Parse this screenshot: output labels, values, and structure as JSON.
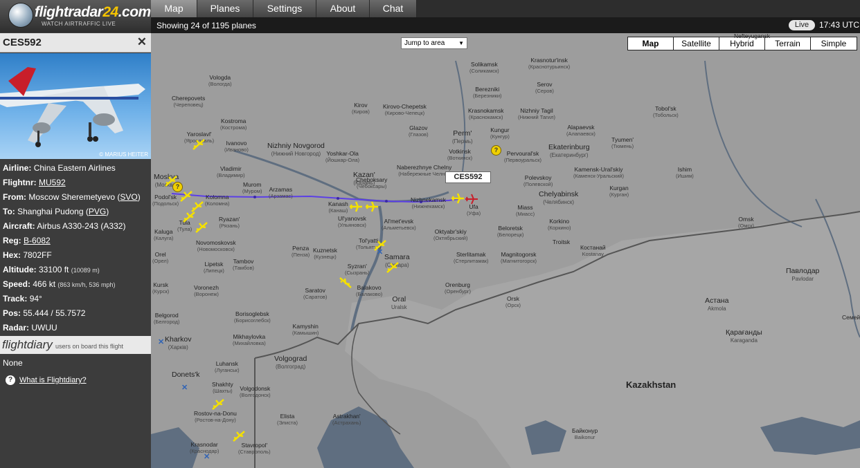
{
  "logo": {
    "brand_main": "flightradar",
    "brand_num": "24",
    "brand_tld": ".com",
    "tagline": "WATCH AIRTRAFFIC LIVE"
  },
  "nav": {
    "tabs": [
      "Map",
      "Planes",
      "Settings",
      "About",
      "Chat"
    ],
    "active": "Map"
  },
  "status": {
    "showing": "Showing 24 of 1195 planes",
    "live": "Live",
    "time": "17:43 UTC"
  },
  "flight": {
    "callsign": "CES592",
    "photo_credit": "© MARIUS HEITER",
    "airline_label": "Airline:",
    "airline": "China Eastern Airlines",
    "flightnr_label": "Flightnr:",
    "flightnr": "MU592",
    "from_label": "From:",
    "from": "Moscow Sheremetyevo (",
    "from_code": "SVO",
    "from_close": ")",
    "to_label": "To:",
    "to": "Shanghai Pudong (",
    "to_code": "PVG",
    "to_close": ")",
    "aircraft_label": "Aircraft:",
    "aircraft": "Airbus A330-243 (A332)",
    "reg_label": "Reg:",
    "reg": "B-6082",
    "hex_label": "Hex:",
    "hex": "7802FF",
    "altitude_label": "Altitude:",
    "altitude": "33100 ft",
    "altitude_m": "(10089 m)",
    "speed_label": "Speed:",
    "speed": "466 kt",
    "speed_alt": "(863 km/h, 536 mph)",
    "track_label": "Track:",
    "track": "94°",
    "pos_label": "Pos:",
    "pos": "55.444 / 55.7572",
    "radar_label": "Radar:",
    "radar": "UWUU"
  },
  "flightdiary": {
    "logo": "flightdiary",
    "text": "users on board this flight",
    "none": "None",
    "what": "What is Flightdiary?"
  },
  "map": {
    "jump": "Jump to area",
    "types": [
      "Map",
      "Satellite",
      "Hybrid",
      "Terrain",
      "Simple"
    ],
    "active_type": "Map",
    "selected_label": "CES592",
    "country": "Kazakhstan",
    "cities": [
      {
        "en": "Solikamsk",
        "ru": "(Соликамск)"
      },
      {
        "en": "Krasnotur'insk",
        "ru": "(Краснотурьинск)"
      },
      {
        "en": "Berezniki",
        "ru": "(Березники)"
      },
      {
        "en": "Serov",
        "ru": "(Серов)"
      },
      {
        "en": "Vologda",
        "ru": "(Вологда)"
      },
      {
        "en": "Cherepovets",
        "ru": "(Череповец)"
      },
      {
        "en": "Kirov",
        "ru": "(Киров)"
      },
      {
        "en": "Kirovo-Chepetsk",
        "ru": "(Кирово-Чепецк)"
      },
      {
        "en": "Krasnokamsk",
        "ru": "(Краснокамск)"
      },
      {
        "en": "Nizhniy Tagil",
        "ru": "(Нижний Тагил)"
      },
      {
        "en": "Tobol'sk",
        "ru": "(Тобольск)"
      },
      {
        "en": "Kostroma",
        "ru": "(Кострома)"
      },
      {
        "en": "Glazov",
        "ru": "(Глазов)"
      },
      {
        "en": "Perm'",
        "ru": "(Пермь)"
      },
      {
        "en": "Kungur",
        "ru": "(Кунгур)"
      },
      {
        "en": "Alapaevsk",
        "ru": "(Алапаевск)"
      },
      {
        "en": "Yaroslavl'",
        "ru": "(Ярославль)"
      },
      {
        "en": "Ivanovo",
        "ru": "(Иваново)"
      },
      {
        "en": "Nizhniy Novgorod",
        "ru": "(Нижний Новгород)"
      },
      {
        "en": "Yoshkar-Ola",
        "ru": "(Йошкар-Ола)"
      },
      {
        "en": "Votkinsk",
        "ru": "(Воткинск)"
      },
      {
        "en": "Pervoural'sk",
        "ru": "(Первоуральск)"
      },
      {
        "en": "Ekaterinburg",
        "ru": "(Екатеринбург)"
      },
      {
        "en": "Tyumen'",
        "ru": "(Тюмень)"
      },
      {
        "en": "Vladimir",
        "ru": "(Владимир)"
      },
      {
        "en": "Kazan'",
        "ru": "(Казань)"
      },
      {
        "en": "Naberezhnye Chelny",
        "ru": "(Набережные Челны)"
      },
      {
        "en": "Kamensk-Ural'skiy",
        "ru": "(Каменск-Уральский)"
      },
      {
        "en": "Ishim",
        "ru": "(Ишим)"
      },
      {
        "en": "Moskva",
        "ru": "(Москва)"
      },
      {
        "en": "Murom",
        "ru": "(Муром)"
      },
      {
        "en": "Arzamas",
        "ru": "(Арзамас)"
      },
      {
        "en": "Polevskoy",
        "ru": "(Полевской)"
      },
      {
        "en": "Chelyabinsk",
        "ru": "(Челябинск)"
      },
      {
        "en": "Kurgan",
        "ru": "(Курган)"
      },
      {
        "en": "Podol'sk",
        "ru": "(Подольск)"
      },
      {
        "en": "Kolomna",
        "ru": "(Коломна)"
      },
      {
        "en": "Kanash",
        "ru": "(Канаш)"
      },
      {
        "en": "Cheboksary",
        "ru": "(Чебоксары)"
      },
      {
        "en": "Nizhnekamsk",
        "ru": "(Нижнекамск)"
      },
      {
        "en": "Ufa",
        "ru": "(Уфа)"
      },
      {
        "en": "Miass",
        "ru": "(Миасс)"
      },
      {
        "en": "Ul'yanovsk",
        "ru": "(Ульяновск)"
      },
      {
        "en": "Al'met'evsk",
        "ru": "(Альметьевск)"
      },
      {
        "en": "Korkino",
        "ru": "(Коркино)"
      },
      {
        "en": "Omsk",
        "ru": "(Омск)"
      },
      {
        "en": "Tula",
        "ru": "(Тула)"
      },
      {
        "en": "Ryazan'",
        "ru": "(Рязань)"
      },
      {
        "en": "Oktyabr'skiy",
        "ru": "(Октябрьский)"
      },
      {
        "en": "Beloretsk",
        "ru": "(Белорецк)"
      },
      {
        "en": "Kaluga",
        "ru": "(Калуга)"
      },
      {
        "en": "Novomoskovsk",
        "ru": "(Новомосковск)"
      },
      {
        "en": "Tol'yatti",
        "ru": "(Тольятти)"
      },
      {
        "en": "Troitsk",
        "ru": ""
      },
      {
        "en": "Костанай",
        "ru": "Kostanay"
      },
      {
        "en": "Orel",
        "ru": "(Орел)"
      },
      {
        "en": "Penza",
        "ru": "(Пенза)"
      },
      {
        "en": "Kuznetsk",
        "ru": "(Кузнецк)"
      },
      {
        "en": "Samara",
        "ru": "(Самара)"
      },
      {
        "en": "Sterlitamak",
        "ru": "(Стерлитамак)"
      },
      {
        "en": "Magnitogorsk",
        "ru": "(Магнитогорск)"
      },
      {
        "en": "Lipetsk",
        "ru": "(Липецк)"
      },
      {
        "en": "Tambov",
        "ru": "(Тамбов)"
      },
      {
        "en": "Syzran'",
        "ru": "(Сызрань)"
      },
      {
        "en": "Павлодар",
        "ru": "Pavlodar"
      },
      {
        "en": "Kursk",
        "ru": "(Курск)"
      },
      {
        "en": "Voronezh",
        "ru": "(Воронеж)"
      },
      {
        "en": "Balakovo",
        "ru": "(Балаково)"
      },
      {
        "en": "Orenburg",
        "ru": "(Оренбург)"
      },
      {
        "en": "Saratov",
        "ru": "(Саратов)"
      },
      {
        "en": "Oral",
        "ru": "Uralsk"
      },
      {
        "en": "Orsk",
        "ru": "(Орск)"
      },
      {
        "en": "Астана",
        "ru": "Akmola"
      },
      {
        "en": "Belgorod",
        "ru": "(Белгород)"
      },
      {
        "en": "Borisoglebsk",
        "ru": "(Борисоглебск)"
      },
      {
        "en": "Kamyshin",
        "ru": "(Камышин)"
      },
      {
        "en": "Kharkov",
        "ru": "(Харків)"
      },
      {
        "en": "Mikhaylovka",
        "ru": "(Михайловка)"
      },
      {
        "en": "Қарағанды",
        "ru": "Karaganda"
      },
      {
        "en": "Luhansk",
        "ru": "(Луганськ)"
      },
      {
        "en": "Volgograd",
        "ru": "(Волгоград)"
      },
      {
        "en": "Donets'k",
        "ru": ""
      },
      {
        "en": "Shakhty",
        "ru": "(Шахты)"
      },
      {
        "en": "Volgodonsk",
        "ru": "(Волгодонск)"
      },
      {
        "en": "Rostov-na-Donu",
        "ru": "(Ростов-на-Дону)"
      },
      {
        "en": "Elista",
        "ru": "(Элиста)"
      },
      {
        "en": "Astrakhan'",
        "ru": "(Астрахань)"
      },
      {
        "en": "Байконур",
        "ru": "Baikonur"
      },
      {
        "en": "Krasnodar",
        "ru": "(Краснодар)"
      },
      {
        "en": "Stavropol'",
        "ru": "(Ставрополь)"
      },
      {
        "en": "Nefteyugansk",
        "ru": ""
      },
      {
        "en": "Семей",
        "ru": ""
      }
    ]
  }
}
